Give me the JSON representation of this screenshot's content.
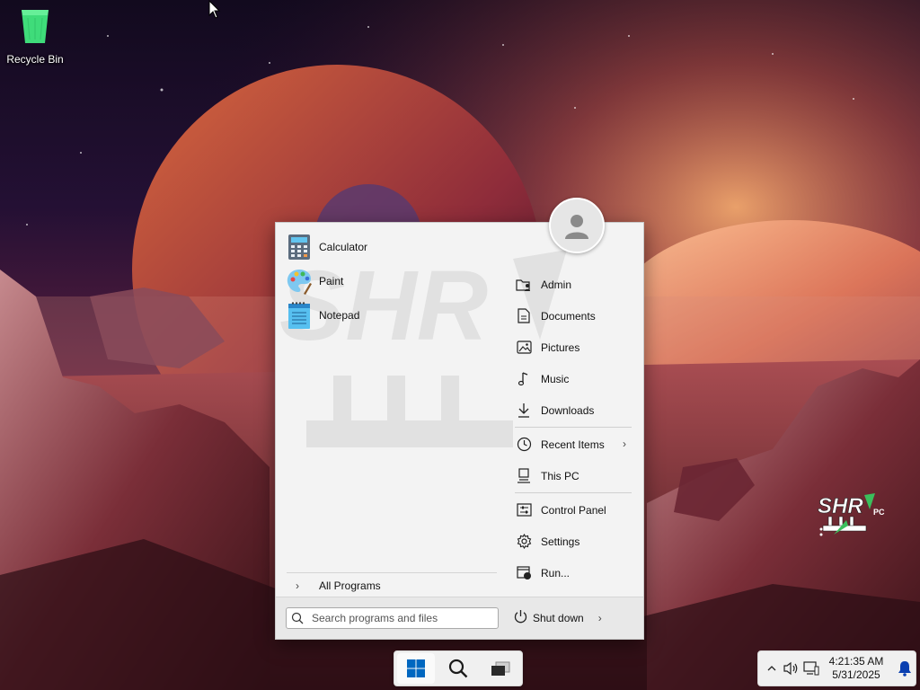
{
  "desktop": {
    "icons": [
      {
        "label": "Recycle Bin",
        "icon": "recycle-bin-icon"
      }
    ],
    "watermark_text": "SHR",
    "watermark_badge": "PC"
  },
  "start_menu": {
    "pinned": [
      {
        "label": "Calculator",
        "icon": "calculator-icon"
      },
      {
        "label": "Paint",
        "icon": "paint-palette-icon"
      },
      {
        "label": "Notepad",
        "icon": "notepad-icon"
      }
    ],
    "all_programs_label": "All Programs",
    "places": [
      {
        "label": "Admin",
        "icon": "user-folder-icon"
      },
      {
        "label": "Documents",
        "icon": "document-icon"
      },
      {
        "label": "Pictures",
        "icon": "picture-icon"
      },
      {
        "label": "Music",
        "icon": "music-note-icon"
      },
      {
        "label": "Downloads",
        "icon": "download-arrow-icon"
      },
      {
        "label": "Recent Items",
        "icon": "clock-icon",
        "has_submenu": true
      },
      {
        "label": "This PC",
        "icon": "computer-icon"
      },
      {
        "label": "Control Panel",
        "icon": "control-panel-icon"
      },
      {
        "label": "Settings",
        "icon": "gear-icon"
      },
      {
        "label": "Run...",
        "icon": "run-icon"
      }
    ],
    "search": {
      "placeholder": "Search programs and files",
      "value": ""
    },
    "shutdown_label": "Shut down"
  },
  "taskbar": {
    "buttons": [
      {
        "name": "start",
        "icon": "windows-logo-icon",
        "active": true
      },
      {
        "name": "search",
        "icon": "search-icon"
      },
      {
        "name": "task-view",
        "icon": "task-view-icon"
      }
    ]
  },
  "tray": {
    "time": "4:21:35 AM",
    "date": "5/31/2025",
    "icons": [
      "chevron-up-icon",
      "speaker-icon",
      "network-icon",
      "notification-bell-icon"
    ]
  },
  "colors": {
    "start_accent": "#0067c0",
    "menu_bg": "#f3f3f3",
    "bell": "#0a3fb0",
    "watermark_green": "#3bbf5c"
  }
}
